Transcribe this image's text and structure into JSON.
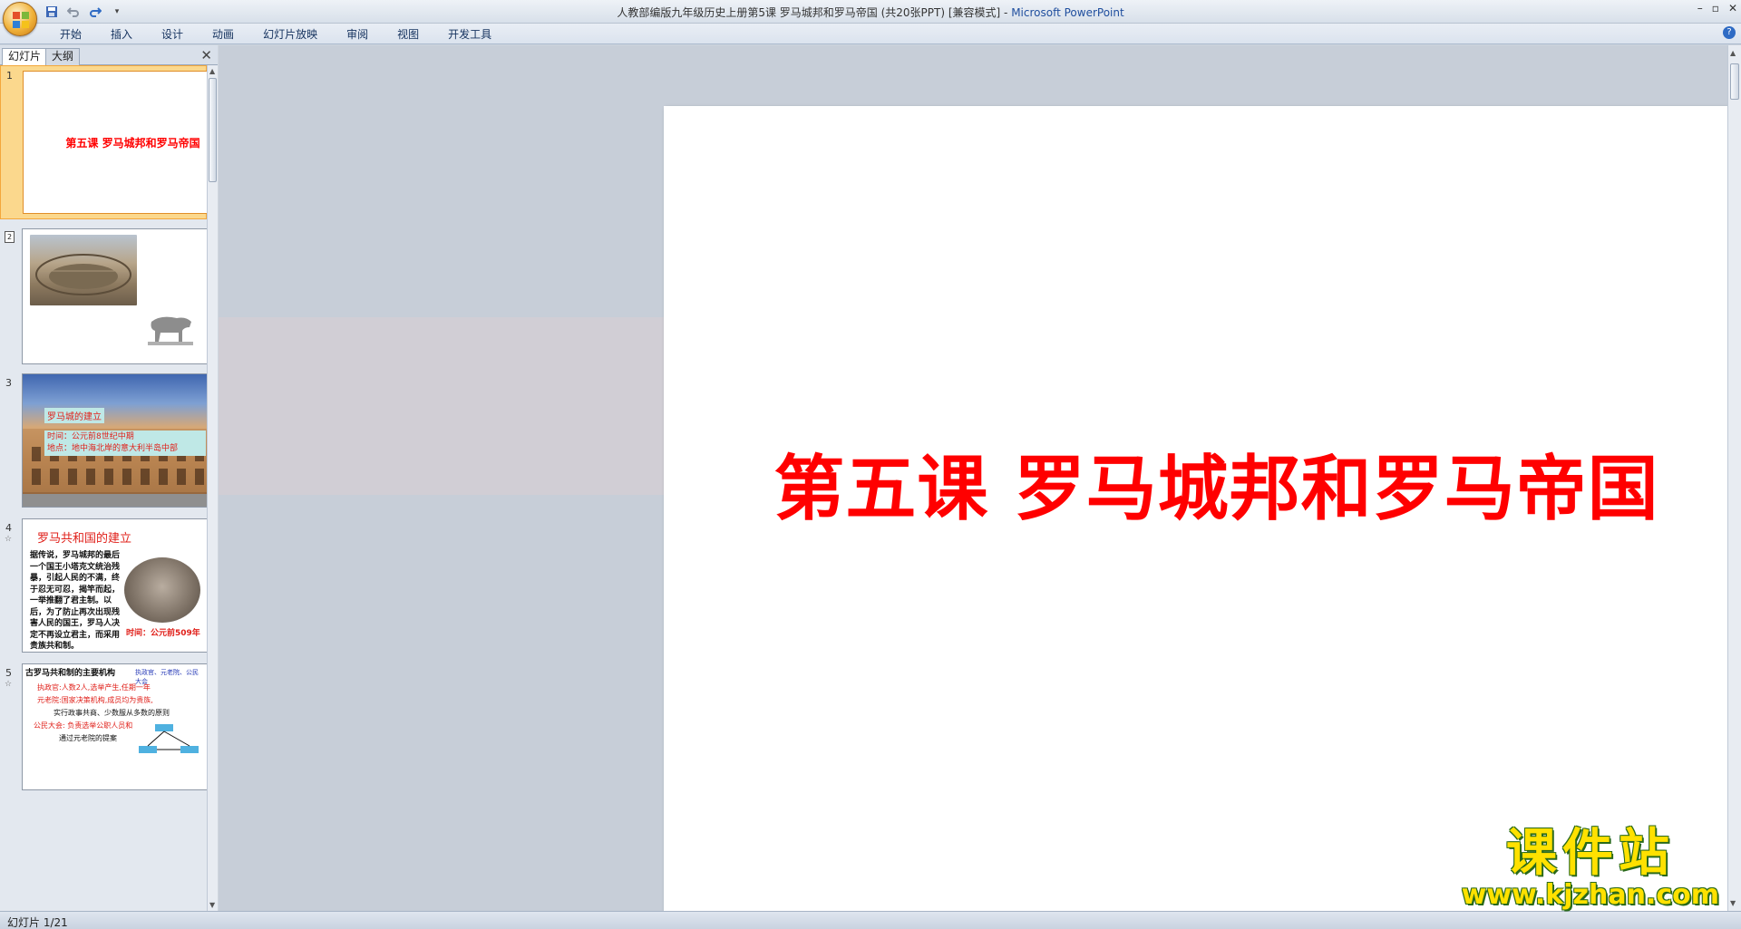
{
  "window": {
    "title": "人教部编版九年级历史上册第5课 罗马城邦和罗马帝国 (共20张PPT) [兼容模式]",
    "app_name": "Microsoft PowerPoint"
  },
  "ribbon": {
    "tabs": [
      "开始",
      "插入",
      "设计",
      "动画",
      "幻灯片放映",
      "审阅",
      "视图",
      "开发工具"
    ]
  },
  "panel": {
    "tabs": [
      "幻灯片",
      "大纲"
    ],
    "slides": [
      {
        "number": "1",
        "title": "第五课 罗马城邦和罗马帝国"
      },
      {
        "number": "2"
      },
      {
        "number": "3",
        "caption": "罗马城的建立",
        "lines": [
          "时间：公元前8世纪中期",
          "地点：地中海北岸的意大利半岛中部"
        ]
      },
      {
        "number": "4",
        "heading": "罗马共和国的建立",
        "body": "据传说，罗马城邦的最后一个国王小塔克文统治残暴，引起人民的不满，终于忍无可忍，揭竿而起，一举推翻了君主制。以后，为了防止再次出现残害人民的国王，罗马人决定不再设立君主，而采用贵族共和制。",
        "time": "时间：公元前509年"
      },
      {
        "number": "5",
        "heading": "古罗马共和制的主要机构",
        "side": "执政官、元老院、公民大会",
        "lines": [
          "执政官:人数2人,选举产生,任期一年",
          "元老院:国家决策机构,成员均为贵族,",
          "实行政事共商、少数服从多数的原则",
          "公民大会: 负责选举公职人员和",
          "通过元老院的提案"
        ]
      }
    ]
  },
  "main_slide": {
    "title": "第五课 罗马城邦和罗马帝国",
    "title_color": "#ff0000"
  },
  "status": {
    "slide_indicator": "幻灯片 1/21"
  },
  "watermark": {
    "title": "课件站",
    "url": "www.kjzhan.com"
  }
}
